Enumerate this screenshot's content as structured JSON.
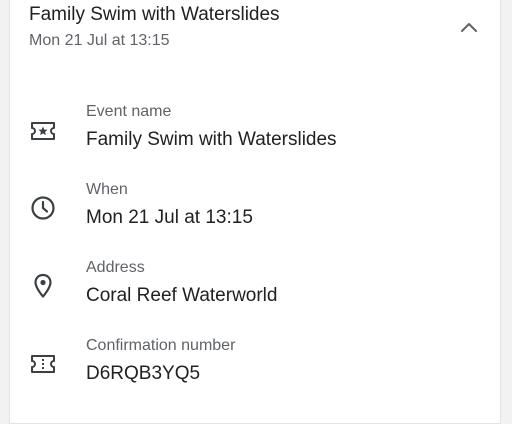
{
  "header": {
    "title": "Family Swim with Waterslides",
    "subtitle": "Mon 21 Jul at 13:15",
    "collapse_icon": "chevron-up-icon"
  },
  "details": [
    {
      "icon": "ticket-star-icon",
      "label": "Event name",
      "value": "Family Swim with Waterslides"
    },
    {
      "icon": "clock-icon",
      "label": "When",
      "value": "Mon 21 Jul at 13:15"
    },
    {
      "icon": "location-pin-icon",
      "label": "Address",
      "value": "Coral Reef Waterworld"
    },
    {
      "icon": "ticket-icon",
      "label": "Confirmation number",
      "value": "D6RQB3YQ5"
    }
  ],
  "colors": {
    "text_primary": "#202124",
    "text_secondary": "#5f6368",
    "icon": "#3c4043"
  }
}
